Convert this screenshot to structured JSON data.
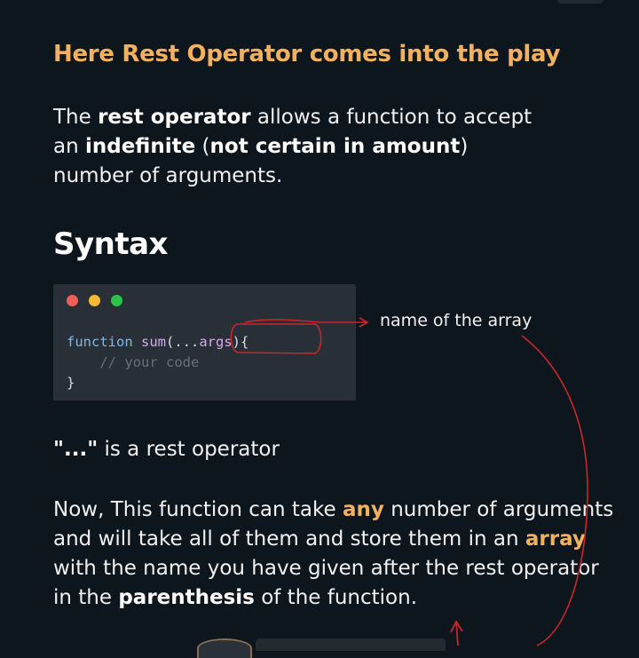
{
  "heading": "Here Rest Operator comes into the play",
  "intro": {
    "t1": "The ",
    "b1": "rest operator",
    "t2": " allows a function to accept an ",
    "b2": "indefinite",
    "t3": " (",
    "b3": "not certain in amount",
    "t4": ") number of arguments."
  },
  "syntax_heading": "Syntax",
  "code": {
    "keyword": "function",
    "name": "sum",
    "open": "(...",
    "param": "args",
    "close": "){",
    "comment": "// your code",
    "end": "}"
  },
  "annotation": "name of the array",
  "rest_note": {
    "bold": "\"...\"",
    "text": " is a rest operator"
  },
  "explanation": {
    "t1": "Now, This function can take ",
    "h1": "any",
    "t2": " number of arguments and will take all of them and store them in an ",
    "h2": "array",
    "t3": " with the name you have given after the rest operator in the ",
    "b1": "parenthesis",
    "t4": " of the function."
  },
  "colors": {
    "background": "#0e161d",
    "accent": "#f2b061",
    "annotation_ink": "#c8262b"
  }
}
